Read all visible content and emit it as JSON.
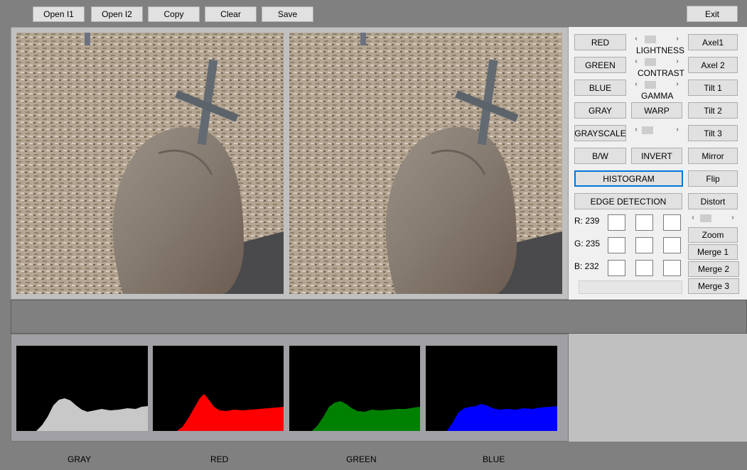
{
  "toolbar": {
    "open1": "Open I1",
    "open2": "Open I2",
    "copy": "Copy",
    "clear": "Clear",
    "save": "Save",
    "exit": "Exit"
  },
  "controls": {
    "red": "RED",
    "green": "GREEN",
    "blue": "BLUE",
    "gray": "GRAY",
    "grayscale": "GRAYSCALE",
    "bw": "B/W",
    "warp": "WARP",
    "invert": "INVERT",
    "histogram": "HISTOGRAM",
    "edge_detection": "EDGE DETECTION",
    "lightness": "LIGHTNESS",
    "contrast": "CONTRAST",
    "gamma": "GAMMA"
  },
  "right_buttons": {
    "axel1": "Axel1",
    "axel2": "Axel 2",
    "tilt1": "Tilt 1",
    "tilt2": "Tilt 2",
    "tilt3": "Tilt 3",
    "mirror": "Mirror",
    "flip": "Flip",
    "distort": "Distort",
    "zoom": "Zoom",
    "merge1": "Merge 1",
    "merge2": "Merge 2",
    "merge3": "Merge 3"
  },
  "pixel_readout": {
    "r": "R: 239",
    "g": "G: 235",
    "b": "B: 232"
  },
  "histogram_labels": {
    "gray": "GRAY",
    "red": "RED",
    "green": "GREEN",
    "blue": "BLUE"
  },
  "colors": {
    "gray_hist": "#c8c8c8",
    "red_hist": "#ff0000",
    "green_hist": "#008000",
    "blue_hist": "#0000ff",
    "focus_border": "#0078d7"
  },
  "icons": {
    "scroll_left": "chevron-left-icon",
    "scroll_right": "chevron-right-icon"
  }
}
